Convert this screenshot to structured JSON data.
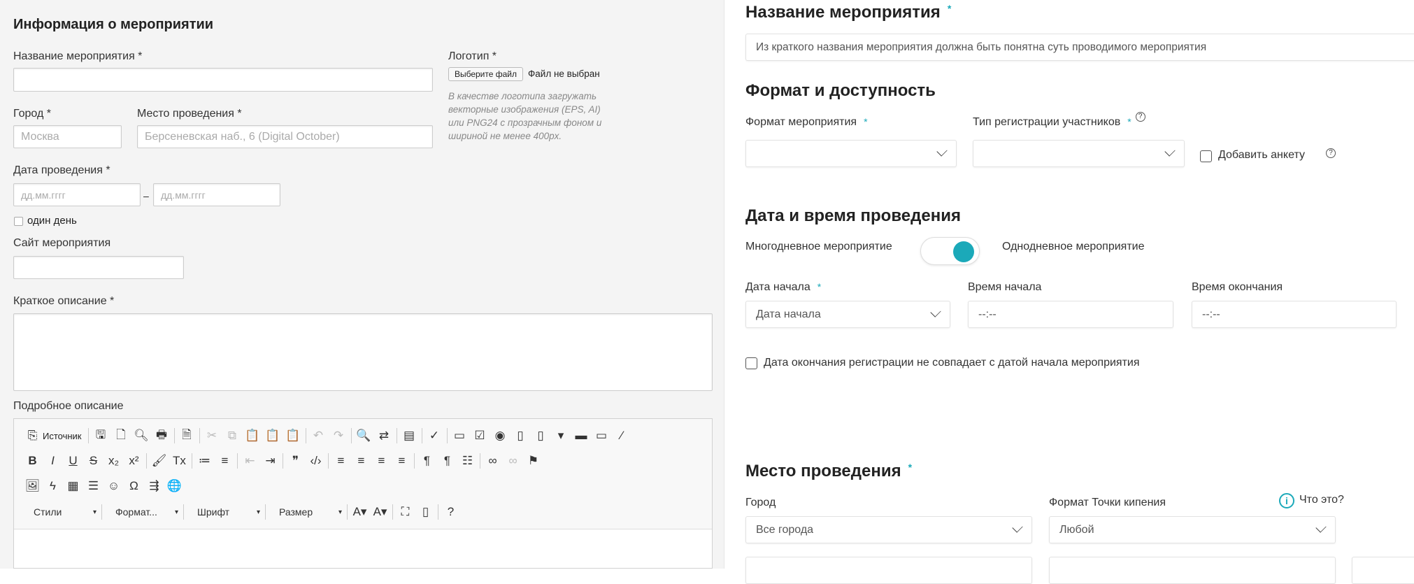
{
  "left": {
    "title": "Информация о мероприятии",
    "name_label": "Название мероприятия *",
    "logo_label": "Логотип *",
    "file_button": "Выберите файл",
    "file_status": "Файл не выбран",
    "logo_help": "В качестве логотипа загружать векторные изображения (EPS, AI) или PNG24 с прозрачным фоном и шириной не менее 400px.",
    "city_label": "Город *",
    "city_placeholder": "Москва",
    "venue_label": "Место проведения *",
    "venue_placeholder": "Берсеневская наб., 6 (Digital October)",
    "date_label": "Дата проведения *",
    "date_from_placeholder": "дд.мм.гггг",
    "date_sep": "–",
    "date_to_placeholder": "дд.мм.гггг",
    "one_day_label": "один день",
    "site_label": "Сайт мероприятия",
    "short_desc_label": "Краткое описание *",
    "full_desc_label": "Подробное описание",
    "editor": {
      "source_label": "Источник",
      "rows": [
        [
          [
            "source-icon",
            "⎘"
          ],
          "|",
          [
            "save-icon",
            "🖫"
          ],
          [
            "new-page-icon",
            "🗋"
          ],
          [
            "preview-icon",
            "🔍︎"
          ],
          [
            "print-icon",
            "🖶"
          ],
          "|",
          [
            "templates-icon",
            "🗎"
          ],
          "|",
          [
            "cut-icon",
            "✂",
            1
          ],
          [
            "copy-icon",
            "⧉",
            1
          ],
          [
            "paste-icon",
            "📋"
          ],
          [
            "paste-text-icon",
            "📋"
          ],
          [
            "paste-word-icon",
            "📋"
          ],
          "|",
          [
            "undo-icon",
            "↶",
            1
          ],
          [
            "redo-icon",
            "↷",
            1
          ],
          "|",
          [
            "find-icon",
            "🔍"
          ],
          [
            "replace-icon",
            "⇄"
          ],
          "|",
          [
            "select-all-icon",
            "▤"
          ],
          "|",
          [
            "spellcheck-icon",
            "✓"
          ],
          "|",
          [
            "form-icon",
            "▭"
          ],
          [
            "checkbox-icon",
            "☑"
          ],
          [
            "radio-icon",
            "◉"
          ],
          [
            "textfield-icon",
            "▯"
          ],
          [
            "textarea-icon",
            "▯"
          ],
          [
            "select-icon",
            "▾"
          ],
          [
            "button-icon",
            "▬"
          ],
          [
            "imagebutton-icon",
            "▭"
          ],
          [
            "hiddenfield-icon",
            "⁄"
          ]
        ],
        [
          [
            "bold-icon",
            "B"
          ],
          [
            "italic-icon",
            "I"
          ],
          [
            "underline-icon",
            "U"
          ],
          [
            "strike-icon",
            "S"
          ],
          [
            "subscript-icon",
            "x₂"
          ],
          [
            "superscript-icon",
            "x²"
          ],
          "|",
          [
            "copy-format-icon",
            "🖌"
          ],
          [
            "remove-format-icon",
            "Tx"
          ],
          "|",
          [
            "numbered-list-icon",
            "≔"
          ],
          [
            "bulleted-list-icon",
            "≡"
          ],
          "|",
          [
            "outdent-icon",
            "⇤",
            1
          ],
          [
            "indent-icon",
            "⇥"
          ],
          "|",
          [
            "blockquote-icon",
            "❞"
          ],
          [
            "div-icon",
            "‹/›"
          ],
          "|",
          [
            "align-left-icon",
            "≡"
          ],
          [
            "align-center-icon",
            "≡"
          ],
          [
            "align-right-icon",
            "≡"
          ],
          [
            "justify-icon",
            "≡"
          ],
          "|",
          [
            "ltr-icon",
            "¶"
          ],
          [
            "rtl-icon",
            "¶"
          ],
          [
            "language-icon",
            "☷"
          ],
          "|",
          [
            "link-icon",
            "∞"
          ],
          [
            "unlink-icon",
            "∞",
            1
          ],
          [
            "anchor-icon",
            "⚑"
          ]
        ],
        [
          [
            "image-icon",
            "🖼"
          ],
          [
            "flash-icon",
            "ϟ"
          ],
          [
            "table-icon",
            "▦"
          ],
          [
            "hr-icon",
            "☰"
          ],
          [
            "smiley-icon",
            "☺"
          ],
          [
            "special-char-icon",
            "Ω"
          ],
          [
            "page-break-icon",
            "⇶"
          ],
          [
            "iframe-icon",
            "🌐"
          ]
        ]
      ],
      "combos": [
        "Стили",
        "Формат...",
        "Шрифт",
        "Размер"
      ],
      "tail": [
        [
          "text-color-icon",
          "A▾"
        ],
        [
          "bg-color-icon",
          "A▾"
        ],
        "|",
        [
          "maximize-icon",
          "⛶"
        ],
        [
          "show-blocks-icon",
          "▯"
        ],
        "|",
        [
          "help-icon",
          "?"
        ]
      ]
    }
  },
  "right": {
    "name_heading": "Название мероприятия",
    "name_placeholder": "Из краткого названия мероприятия должна быть понятна суть проводимого мероприятия",
    "format_heading": "Формат и доступность",
    "format_label": "Формат мероприятия",
    "reg_type_label": "Тип регистрации участников",
    "add_form_label": "Добавить анкету",
    "datetime_heading": "Дата и время проведения",
    "multi_day_label": "Многодневное мероприятие",
    "one_day_label": "Однодневное мероприятие",
    "toggle_on": true,
    "start_date_label": "Дата начала",
    "start_date_value": "Дата начала",
    "start_time_label": "Время начала",
    "start_time_placeholder": "--:--",
    "end_time_label": "Время окончания",
    "end_time_placeholder": "--:--",
    "reg_end_label": "Дата окончания регистрации не совпадает с датой начала мероприятия",
    "venue_heading": "Место проведения",
    "city_label": "Город",
    "city_value": "Все города",
    "point_format_label": "Формат Точки кипения",
    "what_is_it": "Что это?",
    "point_format_value": "Любой",
    "star": "*",
    "help_q": "?",
    "accent": "#1ba9b9"
  }
}
